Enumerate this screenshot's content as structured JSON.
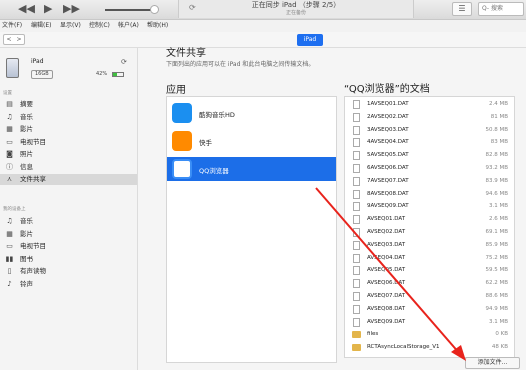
{
  "toolbar": {
    "status_title": "正在同步 iPad （步骤 2/5）",
    "status_sub": "正在备份",
    "search_placeholder": "Q- 搜索"
  },
  "menu": [
    "文件(F)",
    "编辑(E)",
    "显示(V)",
    "控制(C)",
    "帐户(A)",
    "帮助(H)"
  ],
  "device_tab": "iPad",
  "device": {
    "name": "iPad",
    "capacity": "16GB",
    "battery_text": "42%",
    "battery_level": 0.42
  },
  "sidebar": {
    "settings_label": "设置",
    "settings_items": [
      {
        "icon": "summary-icon",
        "label": "摘要"
      },
      {
        "icon": "music-icon",
        "label": "音乐"
      },
      {
        "icon": "movie-icon",
        "label": "影片"
      },
      {
        "icon": "tv-icon",
        "label": "电视节目"
      },
      {
        "icon": "photo-icon",
        "label": "照片"
      },
      {
        "icon": "info-icon",
        "label": "信息"
      },
      {
        "icon": "file-sharing-icon",
        "label": "文件共享"
      }
    ],
    "ondevice_label": "我的设备上",
    "ondevice_items": [
      {
        "icon": "music-icon",
        "label": "音乐"
      },
      {
        "icon": "movie-icon",
        "label": "影片"
      },
      {
        "icon": "tv-icon",
        "label": "电视节目"
      },
      {
        "icon": "book-icon",
        "label": "图书"
      },
      {
        "icon": "audiobook-icon",
        "label": "有声读物"
      },
      {
        "icon": "bell-icon",
        "label": "铃声"
      }
    ]
  },
  "main": {
    "title": "文件共享",
    "subtitle": "下面列出的应用可以在 iPad 和此台电脑之间传输文档。",
    "apps_title": "应用",
    "docs_title": "“QQ浏览器”的文档",
    "apps": [
      {
        "name": "酷狗音乐HD",
        "color": "#1b8ff0"
      },
      {
        "name": "快手",
        "color": "#ff8a00"
      },
      {
        "name": "QQ浏览器",
        "color": "#ffffff"
      }
    ],
    "docs": [
      {
        "name": "1AVSEQ01.DAT",
        "size": "2.4 MB",
        "type": "file"
      },
      {
        "name": "2AVSEQ02.DAT",
        "size": "81 MB",
        "type": "file"
      },
      {
        "name": "3AVSEQ03.DAT",
        "size": "50.8 MB",
        "type": "file"
      },
      {
        "name": "4AVSEQ04.DAT",
        "size": "83 MB",
        "type": "file"
      },
      {
        "name": "5AVSEQ05.DAT",
        "size": "82.8 MB",
        "type": "file"
      },
      {
        "name": "6AVSEQ06.DAT",
        "size": "93.2 MB",
        "type": "file"
      },
      {
        "name": "7AVSEQ07.DAT",
        "size": "83.9 MB",
        "type": "file"
      },
      {
        "name": "8AVSEQ08.DAT",
        "size": "94.6 MB",
        "type": "file"
      },
      {
        "name": "9AVSEQ09.DAT",
        "size": "3.1 MB",
        "type": "file"
      },
      {
        "name": "AVSEQ01.DAT",
        "size": "2.6 MB",
        "type": "file"
      },
      {
        "name": "AVSEQ02.DAT",
        "size": "69.1 MB",
        "type": "file"
      },
      {
        "name": "AVSEQ03.DAT",
        "size": "85.9 MB",
        "type": "file"
      },
      {
        "name": "AVSEQ04.DAT",
        "size": "75.2 MB",
        "type": "file"
      },
      {
        "name": "AVSEQ05.DAT",
        "size": "59.5 MB",
        "type": "file"
      },
      {
        "name": "AVSEQ06.DAT",
        "size": "62.2 MB",
        "type": "file"
      },
      {
        "name": "AVSEQ07.DAT",
        "size": "88.6 MB",
        "type": "file"
      },
      {
        "name": "AVSEQ08.DAT",
        "size": "94.9 MB",
        "type": "file"
      },
      {
        "name": "AVSEQ09.DAT",
        "size": "3.1 MB",
        "type": "file"
      },
      {
        "name": "files",
        "size": "0 KB",
        "type": "folder"
      },
      {
        "name": "RCTAsyncLocalStorage_V1",
        "size": "48 KB",
        "type": "folder"
      }
    ],
    "add_button": "添加文件..."
  },
  "colors": {
    "accent": "#1c6ee8",
    "annotation_arrow": "#e8231c"
  }
}
